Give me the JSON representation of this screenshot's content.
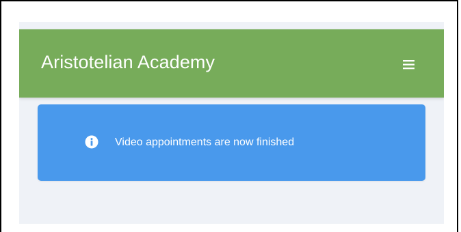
{
  "app": {
    "brand_title": "Aristotelian Academy",
    "menu_icon": "hamburger-menu-icon"
  },
  "alert": {
    "icon": "info-icon",
    "message": "Video appointments are now finished"
  },
  "colors": {
    "navbar_background": "#77ac5a",
    "page_background": "#eff2f7",
    "alert_background": "#4999ec",
    "text_on_color": "#ffffff"
  }
}
